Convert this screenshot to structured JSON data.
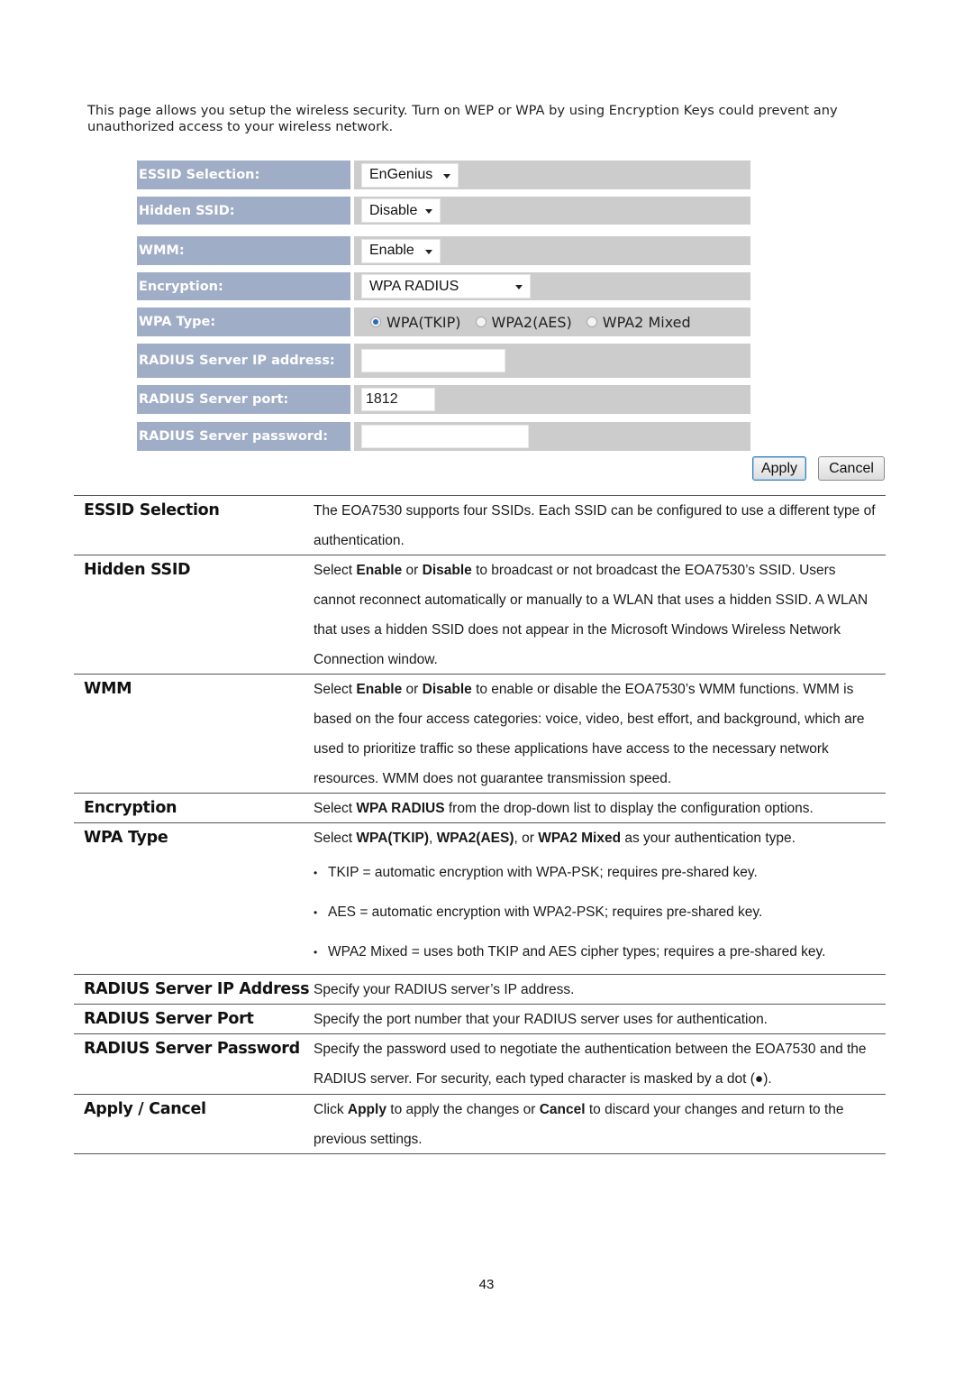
{
  "intro_text": "This page allows you setup the wireless security. Turn on WEP or WPA by using Encryption Keys could prevent any unauthorized access to your wireless network.",
  "form": {
    "essid_label": "ESSID Selection:",
    "essid_value": "EnGenius",
    "hidden_label": "Hidden SSID:",
    "hidden_value": "Disable",
    "wmm_label": "WMM:",
    "wmm_value": "Enable",
    "encryption_label": "Encryption:",
    "encryption_value": "WPA RADIUS",
    "wpa_type_label": "WPA Type:",
    "wpa_type_options": [
      "WPA(TKIP)",
      "WPA2(AES)",
      "WPA2 Mixed"
    ],
    "wpa_type_selected": "WPA(TKIP)",
    "radius_ip_label": "RADIUS Server IP address:",
    "radius_ip_value": "",
    "radius_port_label": "RADIUS Server port:",
    "radius_port_value": "1812",
    "radius_password_label": "RADIUS Server password:",
    "radius_password_value": "",
    "apply_label": "Apply",
    "cancel_label": "Cancel"
  },
  "table": {
    "rows": [
      {
        "term": "ESSID Selection",
        "desc": "The EOA7530 supports four SSIDs. Each SSID can be configured to use a different type of authentication."
      },
      {
        "term": "Hidden SSID",
        "desc_parts": [
          "Select ",
          "Enable",
          " or ",
          "Disable",
          " to broadcast or not broadcast the EOA7530’s SSID. Users cannot reconnect automatically or manually to a WLAN that uses a hidden SSID. A WLAN that uses a hidden SSID does not appear in the Microsoft Windows Wireless Network Connection window."
        ]
      },
      {
        "term": "WMM",
        "desc_parts": [
          "Select ",
          "Enable",
          " or ",
          "Disable",
          " to enable or disable the EOA7530’s WMM functions. WMM is based on the four access categories: voice, video, best effort, and background, which are used to prioritize traffic so these applications have access to the necessary network resources. WMM does not guarantee transmission speed."
        ]
      },
      {
        "term": "Encryption",
        "desc_parts": [
          "Select ",
          "WPA RADIUS",
          " from the drop-down list to display the configuration options."
        ]
      },
      {
        "term": "WPA Type",
        "desc_parts": [
          "Select ",
          "WPA(TKIP)",
          ", ",
          "WPA2(AES)",
          ", or ",
          "WPA2 Mixed",
          " as your authentication type."
        ],
        "bullets": [
          "TKIP = automatic encryption with WPA-PSK; requires pre-shared key.",
          "AES = automatic encryption with WPA2-PSK; requires pre-shared key.",
          "WPA2 Mixed = uses both TKIP and AES cipher types; requires a pre-shared key."
        ]
      },
      {
        "term": "RADIUS Server IP Address",
        "desc": "Specify your RADIUS server’s IP address."
      },
      {
        "term": "RADIUS Server Port",
        "desc": "Specify the port number that your RADIUS server uses for authentication."
      },
      {
        "term": "RADIUS Server Password",
        "desc": "Specify the password used to negotiate the authentication between the EOA7530 and the RADIUS server. For security, each typed character is masked by a dot (●)."
      },
      {
        "term": "Apply / Cancel",
        "desc_parts": [
          "Click ",
          "Apply",
          " to apply the changes or ",
          "Cancel",
          " to discard your changes and return to the previous settings."
        ]
      }
    ]
  },
  "page_number": "43"
}
